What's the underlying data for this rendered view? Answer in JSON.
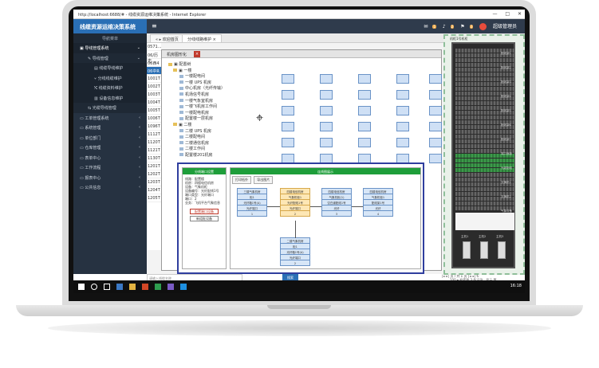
{
  "browser": {
    "title": "http://localhost:6688/# - 线缆资源运维决策系统 - Internet Explorer",
    "controls": [
      "—",
      "□",
      "✕"
    ]
  },
  "header": {
    "brand": "线缆资源运维决策系统",
    "menu_icon": "hamburger-icon",
    "badges": [
      "1",
      "2",
      "3"
    ],
    "user": "超级管理员"
  },
  "sidebar": {
    "head": "导航菜单",
    "items": [
      {
        "label": "▣ 导线管理系统",
        "level": 0,
        "arrow": "⌄",
        "active": true
      },
      {
        "label": "✎ 导线管理",
        "level": 1,
        "arrow": "⌄"
      },
      {
        "label": "▤ 线缆导线维护",
        "level": 2,
        "arrow": ""
      },
      {
        "label": "⑂ 分线线缆维护",
        "level": 2,
        "arrow": ""
      },
      {
        "label": "⤭ 线缆资料维护",
        "level": 2,
        "arrow": ""
      },
      {
        "label": "▥ 设备信息维护",
        "level": 2,
        "arrow": ""
      },
      {
        "label": "⇆ 光缆导线管理",
        "level": 1,
        "arrow": ""
      },
      {
        "label": "▭ 工单管理系统",
        "level": 0,
        "arrow": "‹"
      },
      {
        "label": "▭ 系统管理",
        "level": 0,
        "arrow": "‹"
      },
      {
        "label": "▭ 单位部门",
        "level": 0,
        "arrow": "‹"
      },
      {
        "label": "▭ 仓库管理",
        "level": 0,
        "arrow": "‹"
      },
      {
        "label": "▭ 表单中心",
        "level": 0,
        "arrow": "‹"
      },
      {
        "label": "▭ 工作流程",
        "level": 0,
        "arrow": "‹"
      },
      {
        "label": "▭ 报表中心",
        "level": 0,
        "arrow": "‹"
      },
      {
        "label": "▭ 公共信息",
        "level": 0,
        "arrow": "‹"
      }
    ]
  },
  "tabs": [
    {
      "label": "« ▸ 欢迎首页"
    },
    {
      "label": "分线线路维护 ×"
    }
  ],
  "left_list": [
    "0571...",
    "06/历史",
    "06西4",
    "06中R",
    "1001T",
    "1002T",
    "1003T",
    "1004T",
    "1005T",
    "1006T",
    "1096T",
    "1112T",
    "1120T",
    "1121T",
    "1130T",
    "1201T",
    "1202T",
    "1203T",
    "1204T",
    "1205T"
  ],
  "window": {
    "title": "机房图形化",
    "close": "×",
    "tree": [
      "▣ 配置树",
      "▣ 一楼",
      "一楼配电间",
      "一楼 UPS 机房",
      "中心机房（光纤传输）",
      "机场信号机房",
      "一楼气象室机房",
      "一楼飞机房工作间",
      "一楼配电机房",
      "配置楼一层机房",
      "▣ 二楼",
      "二楼 UPS 机房",
      "二楼配电间",
      "二楼通信机房",
      "二楼工作间",
      "配置楼201机房"
    ],
    "compass": "⌖"
  },
  "inset": {
    "left_title": "分线端口设置",
    "info": [
      "线路：配置楼",
      "机房：四楼电信机房",
      "设备：气象机柜",
      "设备编号：光纤配线1号",
      "端口类型：光纤端口",
      "端口：2",
      "业务：飞机平台气象信息"
    ],
    "red_button": "配置端口设备",
    "grey_button": "新组批设备",
    "right_title": "连线图展示",
    "mini_tabs": [
      "打印拓扑",
      "导出图片"
    ],
    "nodes": [
      {
        "title": "三楼气象机房",
        "rows": [
          "柜1",
          "光纤箱1号(A)",
          "光纤端口"
        ],
        "yellow": false
      },
      {
        "title": "四楼电信机房",
        "rows": [
          "气象机柜1",
          "光纤配线1号",
          "光纤端口"
        ],
        "yellow": true
      },
      {
        "title": "四楼电信机房",
        "rows": [
          "气象机柜(1)",
          "空白道配线1号",
          "光纤"
        ],
        "yellow": false
      },
      {
        "title": "四楼电信机房",
        "rows": [
          "气象机柜1",
          "配线架1号",
          "光纤"
        ],
        "yellow": false
      },
      {
        "title": "二楼气象机房",
        "rows": [
          "柜1",
          "光纤箱1号(A)",
          "光纤端口"
        ],
        "yellow": false
      }
    ],
    "node_ports": [
      "1",
      "2",
      "3",
      "4",
      "2"
    ]
  },
  "rack": {
    "title": "机柜1号机柜",
    "labels": [
      "配线架1",
      "配线架2",
      "配线架3",
      "配线架4",
      "配线架5",
      "配线架6",
      "配线架7",
      "端口面板",
      "光缆配线",
      "交换机1",
      "交换机2",
      "气象设备"
    ],
    "devices": [
      "主机1",
      "主机2",
      "主机3"
    ]
  },
  "pager": {
    "main": "|◂ ◂ | 页 / 共 1 页 | ▸ ▸| ↻",
    "size": "100 ▾",
    "summary": "检索到 3 条记录，显示 第"
  },
  "search": {
    "placeholder": "请输入线缆名称",
    "button": "搜索"
  },
  "status": {
    "zoom": "🔍 100%"
  },
  "taskbar": {
    "time": "16:18"
  }
}
